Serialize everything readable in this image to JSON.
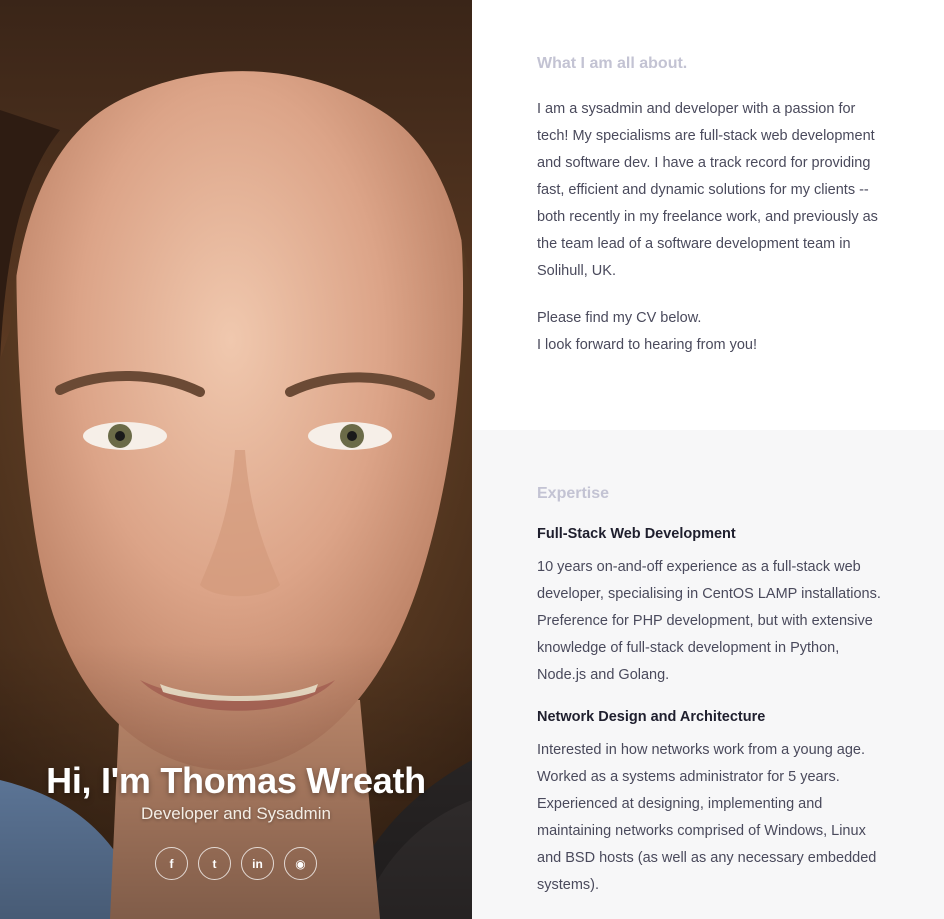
{
  "hero": {
    "name": "Hi, I'm Thomas Wreath",
    "subtitle": "Developer and Sysadmin",
    "socials": [
      {
        "icon": "facebook-icon",
        "glyph": "f"
      },
      {
        "icon": "twitter-icon",
        "glyph": "t"
      },
      {
        "icon": "linkedin-icon",
        "glyph": "in"
      },
      {
        "icon": "github-icon",
        "glyph": "◉"
      }
    ]
  },
  "about": {
    "title": "What I am all about.",
    "paragraph_1": "I am a sysadmin and developer with a passion for tech! My specialisms are full-stack web development and software dev. I have a track record for providing fast, efficient and dynamic solutions for my clients -- both recently in my freelance work, and previously as the team lead of a software development team in Solihull, UK.",
    "paragraph_2_line_1": "Please find my CV below.",
    "paragraph_2_line_2": "I look forward to hearing from you!"
  },
  "expertise": {
    "title": "Expertise",
    "items": [
      {
        "heading": "Full-Stack Web Development",
        "text": "10 years on-and-off experience as a full-stack web developer, specialising in CentOS LAMP installations. Preference for PHP development, but with extensive knowledge of full-stack development in Python, Node.js and Golang."
      },
      {
        "heading": "Network Design and Architecture",
        "text": "Interested in how networks work from a young age. Worked as a systems administrator for 5 years. Experienced at designing, implementing and maintaining networks comprised of Windows, Linux and BSD hosts (as well as any necessary embedded systems)."
      }
    ]
  },
  "colors": {
    "section_title": "#c3c3d3",
    "body_text": "#4a4a5c",
    "heading_text": "#1f1f2e",
    "expertise_bg": "#f7f7f8"
  }
}
